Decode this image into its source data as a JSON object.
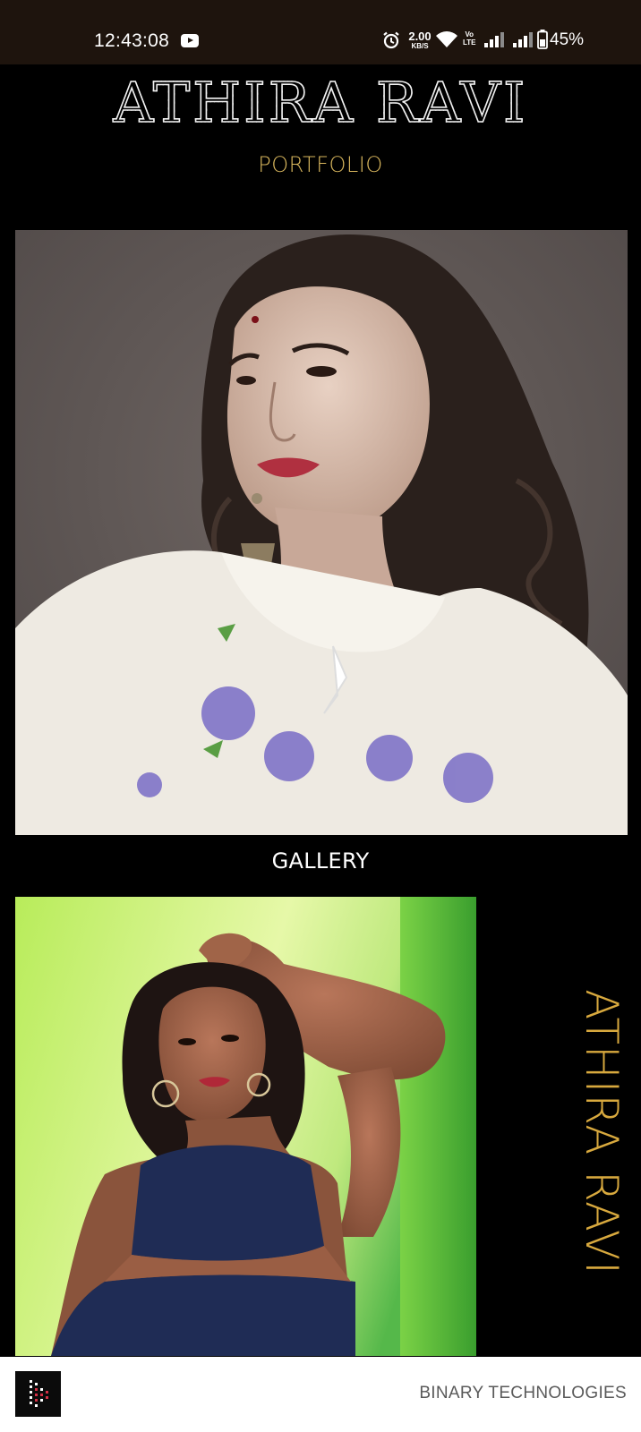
{
  "status_bar": {
    "time": "12:43:08",
    "net_speed_value": "2.00",
    "net_speed_unit": "KB/S",
    "volte_label_top": "Vo",
    "volte_label_bottom": "LTE",
    "battery_percent": "45%",
    "icons": [
      "youtube-icon",
      "alarm-icon",
      "wifi-icon",
      "signal-icon",
      "signal-icon",
      "battery-icon"
    ]
  },
  "header": {
    "title": "ATHIRA RAVI",
    "subtitle": "PORTFOLIO"
  },
  "gallery": {
    "heading": "GALLERY",
    "side_label": "ATHIRA RAVI"
  },
  "footer": {
    "company": "BINARY TECHNOLOGIES"
  },
  "colors": {
    "accent_gold": "#d8b65d",
    "status_bar_bg": "#1e140d",
    "page_bg": "#000000",
    "footer_bg": "#ffffff"
  }
}
